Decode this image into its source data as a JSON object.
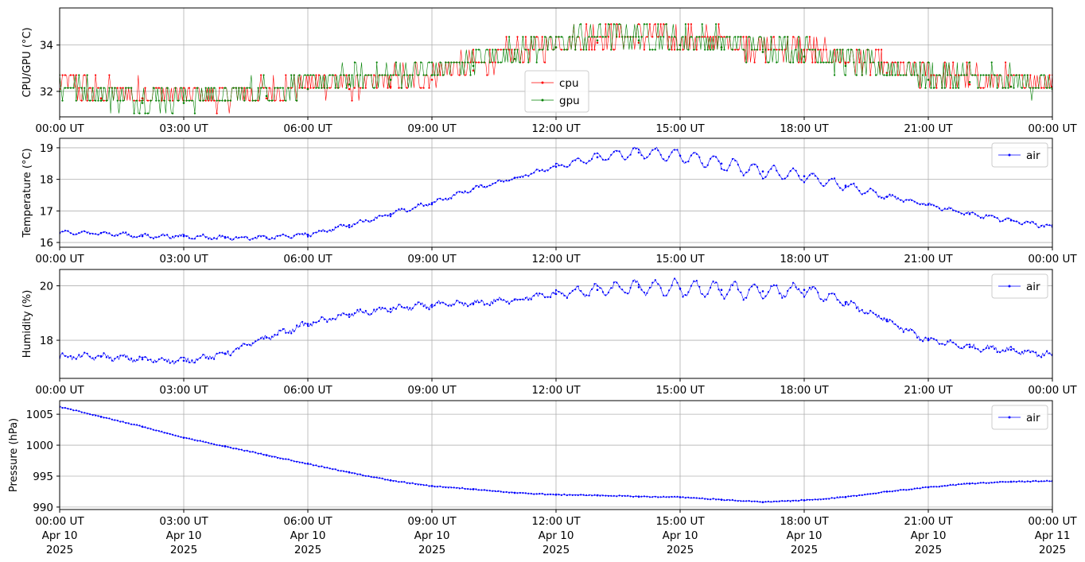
{
  "x_axis": {
    "range_hours": [
      0,
      24
    ],
    "tick_hours": [
      0,
      3,
      6,
      9,
      12,
      15,
      18,
      21,
      24
    ],
    "tick_labels": [
      "00:00 UT",
      "03:00 UT",
      "06:00 UT",
      "09:00 UT",
      "12:00 UT",
      "15:00 UT",
      "18:00 UT",
      "21:00 UT",
      "00:00 UT"
    ],
    "bottom_date_labels": [
      [
        "Apr 10",
        "2025"
      ],
      [
        "Apr 10",
        "2025"
      ],
      [
        "Apr 10",
        "2025"
      ],
      [
        "Apr 10",
        "2025"
      ],
      [
        "Apr 10",
        "2025"
      ],
      [
        "Apr 10",
        "2025"
      ],
      [
        "Apr 10",
        "2025"
      ],
      [
        "Apr 10",
        "2025"
      ],
      [
        "Apr 11",
        "2025"
      ]
    ]
  },
  "chart_data": [
    {
      "type": "line",
      "ylabel": "CPU/GPU (°C)",
      "ylim": [
        30.9,
        35.6
      ],
      "yticks": [
        32,
        34
      ],
      "grid": true,
      "legend": "bottom-center",
      "series": [
        {
          "name": "cpu",
          "color": "#ff0000",
          "x_hours": [
            0,
            1,
            2,
            3,
            4,
            5,
            6,
            7,
            8,
            9,
            10,
            11,
            12,
            13,
            14,
            15,
            16,
            17,
            18,
            19,
            20,
            21,
            22,
            23,
            24
          ],
          "values": [
            32.1,
            31.7,
            31.7,
            31.6,
            31.6,
            31.7,
            32.1,
            32.1,
            32.2,
            32.5,
            32.9,
            33.4,
            33.9,
            34.1,
            34.1,
            34.0,
            33.9,
            33.7,
            33.5,
            33.2,
            32.8,
            32.5,
            32.3,
            32.2,
            32.2
          ]
        },
        {
          "name": "gpu",
          "color": "#008000",
          "x_hours": [
            0,
            1,
            2,
            3,
            4,
            5,
            6,
            7,
            8,
            9,
            10,
            11,
            12,
            13,
            14,
            15,
            16,
            17,
            18,
            19,
            20,
            21,
            22,
            23,
            24
          ],
          "values": [
            32.0,
            31.6,
            31.5,
            31.5,
            31.6,
            31.8,
            32.1,
            32.3,
            32.5,
            32.7,
            33.1,
            33.4,
            33.9,
            34.2,
            34.2,
            34.0,
            33.9,
            33.7,
            33.5,
            33.1,
            32.7,
            32.5,
            32.4,
            32.2,
            32.1
          ]
        }
      ]
    },
    {
      "type": "line",
      "ylabel": "Temperature (°C)",
      "ylim": [
        15.85,
        19.3
      ],
      "yticks": [
        16,
        17,
        18,
        19
      ],
      "grid": true,
      "legend": "top-right",
      "series": [
        {
          "name": "air",
          "color": "#0000ff",
          "x_hours": [
            0,
            1,
            2,
            3,
            4,
            5,
            6,
            7,
            8,
            9,
            10,
            11,
            12,
            13,
            14,
            15,
            16,
            17,
            18,
            19,
            20,
            21,
            22,
            23,
            24
          ],
          "values": [
            16.3,
            16.3,
            16.2,
            16.2,
            16.15,
            16.15,
            16.25,
            16.55,
            16.9,
            17.25,
            17.7,
            18.05,
            18.4,
            18.7,
            18.85,
            18.75,
            18.5,
            18.25,
            18.1,
            17.8,
            17.45,
            17.2,
            16.9,
            16.7,
            16.5
          ]
        }
      ]
    },
    {
      "type": "line",
      "ylabel": "Humidity (%)",
      "ylim": [
        16.6,
        20.6
      ],
      "yticks": [
        18,
        20
      ],
      "grid": true,
      "legend": "top-right",
      "series": [
        {
          "name": "air",
          "color": "#0000ff",
          "x_hours": [
            0,
            1,
            2,
            3,
            4,
            5,
            6,
            7,
            8,
            9,
            10,
            11,
            12,
            13,
            14,
            15,
            16,
            17,
            18,
            19,
            20,
            21,
            22,
            23,
            24
          ],
          "values": [
            17.4,
            17.4,
            17.3,
            17.25,
            17.5,
            18.1,
            18.6,
            18.95,
            19.15,
            19.3,
            19.35,
            19.5,
            19.7,
            19.85,
            19.95,
            19.9,
            19.85,
            19.8,
            19.85,
            19.4,
            18.7,
            18.0,
            17.75,
            17.65,
            17.45
          ]
        }
      ]
    },
    {
      "type": "line",
      "ylabel": "Pressure (hPa)",
      "ylim": [
        989.6,
        1007.2
      ],
      "yticks": [
        990,
        995,
        1000,
        1005
      ],
      "grid": true,
      "legend": "top-right",
      "series": [
        {
          "name": "air",
          "color": "#0000ff",
          "x_hours": [
            0,
            1,
            2,
            3,
            4,
            5,
            6,
            7,
            8,
            9,
            10,
            11,
            12,
            13,
            14,
            15,
            16,
            17,
            18,
            19,
            20,
            21,
            22,
            23,
            24
          ],
          "values": [
            1006.2,
            1004.6,
            1003.0,
            1001.2,
            999.8,
            998.4,
            997.0,
            995.6,
            994.3,
            993.4,
            992.9,
            992.3,
            992.0,
            991.9,
            991.7,
            991.6,
            991.2,
            990.8,
            991.1,
            991.6,
            992.5,
            993.2,
            993.8,
            994.1,
            994.2
          ]
        }
      ]
    }
  ]
}
